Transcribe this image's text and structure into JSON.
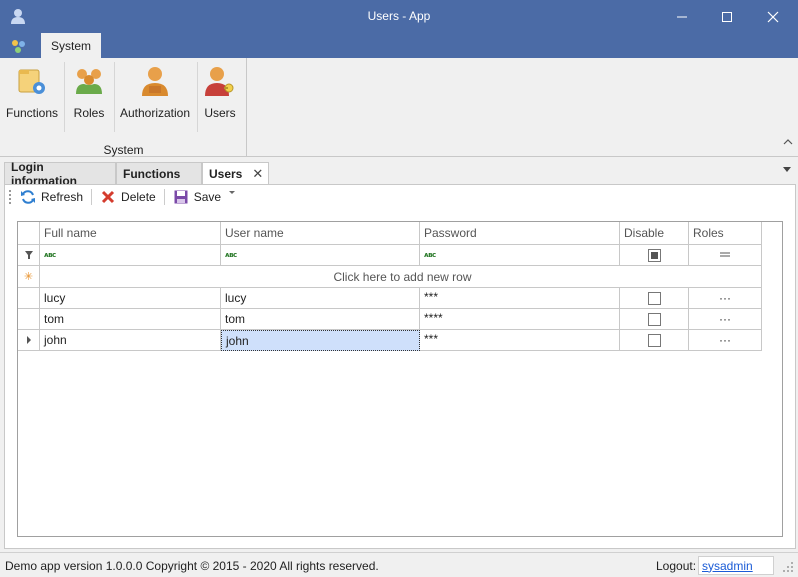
{
  "window": {
    "title": "Users - App"
  },
  "ribbon": {
    "tab": "System",
    "group_label": "System",
    "buttons": [
      {
        "label": "Functions",
        "icon": "folder-gear-icon"
      },
      {
        "label": "Roles",
        "icon": "people-group-icon"
      },
      {
        "label": "Authorization",
        "icon": "user-dx-icon"
      },
      {
        "label": "Users",
        "icon": "user-key-icon"
      }
    ]
  },
  "doc_tabs": [
    {
      "label": "Login information"
    },
    {
      "label": "Functions"
    },
    {
      "label": "Users",
      "active": true
    }
  ],
  "toolbar": {
    "refresh": "Refresh",
    "delete": "Delete",
    "save": "Save"
  },
  "grid": {
    "columns": [
      "Full name",
      "User name",
      "Password",
      "Disable",
      "Roles"
    ],
    "new_row_text": "Click here to add new row",
    "rows": [
      {
        "full_name": "lucy",
        "user_name": "lucy",
        "password": "***",
        "disable": false,
        "roles": "···"
      },
      {
        "full_name": "tom",
        "user_name": "tom",
        "password": "****",
        "disable": false,
        "roles": "···"
      },
      {
        "full_name": "john",
        "user_name": "john",
        "password": "***",
        "disable": false,
        "roles": "···",
        "focused": true
      }
    ]
  },
  "statusbar": {
    "version": "Demo app version 1.0.0.0 Copyright © 2015 - 2020 All rights reserved.",
    "logout_label": "Logout:",
    "user": "sysadmin"
  },
  "colors": {
    "titlebar": "#4b6ba6",
    "selection": "#cfe0fb",
    "link": "#1a5bd6"
  }
}
